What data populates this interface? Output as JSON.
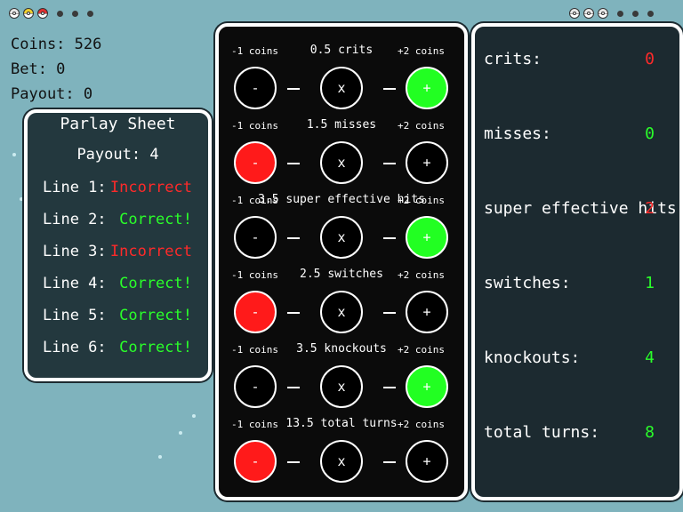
{
  "tray": {
    "left_balls": [
      {
        "kind": "poke-ball",
        "top_color": "#e8e8e8"
      },
      {
        "kind": "ultra-ball",
        "top_color": "#f0d030"
      },
      {
        "kind": "poke-ball",
        "top_color": "#e03030"
      }
    ],
    "right_balls": [
      {
        "kind": "poke-ball",
        "top_color": "#e8e8e8"
      },
      {
        "kind": "poke-ball",
        "top_color": "#e8e8e8"
      },
      {
        "kind": "poke-ball",
        "top_color": "#e8e8e8"
      }
    ]
  },
  "stats": {
    "coins": "Coins: 526",
    "bet": "Bet: 0",
    "payout": "Payout: 0"
  },
  "parlay": {
    "title": "Parlay Sheet",
    "payout": "Payout: 4",
    "lines": [
      {
        "label": "Line 1:",
        "result": "Incorrect",
        "status": "incorrect"
      },
      {
        "label": "Line 2:",
        "result": "Correct!",
        "status": "correct"
      },
      {
        "label": "Line 3:",
        "result": "Incorrect",
        "status": "incorrect"
      },
      {
        "label": "Line 4:",
        "result": "Correct!",
        "status": "correct"
      },
      {
        "label": "Line 5:",
        "result": "Correct!",
        "status": "correct"
      },
      {
        "label": "Line 6:",
        "result": "Correct!",
        "status": "correct"
      }
    ]
  },
  "bets": {
    "minus_label": "-1 coins",
    "plus_label": "+2 coins",
    "minus_symbol": "-",
    "center_symbol": "x",
    "plus_symbol": "+",
    "rows": [
      {
        "title": "0.5 crits",
        "selected": "plus"
      },
      {
        "title": "1.5 misses",
        "selected": "minus"
      },
      {
        "title": "3.5 super effective hits",
        "selected": "plus"
      },
      {
        "title": "2.5 switches",
        "selected": "minus"
      },
      {
        "title": "3.5 knockouts",
        "selected": "plus"
      },
      {
        "title": "13.5 total turns",
        "selected": "minus"
      }
    ]
  },
  "results": [
    {
      "label": "crits:",
      "value": "0",
      "color": "red"
    },
    {
      "label": "misses:",
      "value": "0",
      "color": "green"
    },
    {
      "label": "super effective hits:",
      "value": "2",
      "color": "red"
    },
    {
      "label": "switches:",
      "value": "1",
      "color": "green"
    },
    {
      "label": "knockouts:",
      "value": "4",
      "color": "green"
    },
    {
      "label": "total turns:",
      "value": "8",
      "color": "green"
    }
  ],
  "colors": {
    "background": "#7fb3bd",
    "correct": "#2aff2a",
    "incorrect": "#ff2a2a",
    "selected_plus": "#22ff22",
    "selected_minus": "#ff1a1a"
  }
}
